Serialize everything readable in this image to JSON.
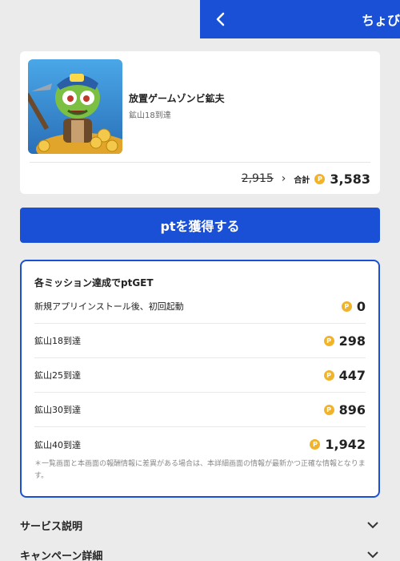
{
  "header": {
    "title": "ちょびリッチ",
    "back_icon": "chevron-left-icon",
    "background": "#1a50d6"
  },
  "app": {
    "name": "放置ゲームゾンビ鉱夫",
    "subtitle": "鉱山18到達",
    "icon": "zombie-miner-app-icon",
    "old_points": "2,915",
    "arrow": "›",
    "total_label": "合計",
    "coin_glyph": "P",
    "total_points": "3,583"
  },
  "cta": {
    "label": "ptを獲得する"
  },
  "missions": {
    "title": "各ミッション達成でptGET",
    "items": [
      {
        "label": "新規アプリインストール後、初回起動",
        "points": "0"
      },
      {
        "label": "鉱山18到達",
        "points": "298"
      },
      {
        "label": "鉱山25到達",
        "points": "447"
      },
      {
        "label": "鉱山30到達",
        "points": "896"
      },
      {
        "label": "鉱山40到達",
        "points": "1,942"
      }
    ],
    "note": "＊一覧画面と本画面の報酬情報に差異がある場合は、本詳細画面の情報が最新かつ正確な情報となります。"
  },
  "sections": [
    {
      "label": "サービス説明"
    },
    {
      "label": "キャンペーン詳細"
    }
  ],
  "colors": {
    "accent": "#1a50d6",
    "coin": "#f0b32c"
  }
}
